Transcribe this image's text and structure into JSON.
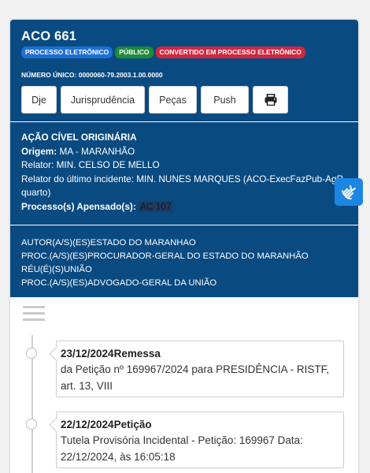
{
  "process": {
    "title": "ACO 661",
    "badges": [
      {
        "label": "PROCESSO ELETRÔNICO",
        "color": "#1d6fd6"
      },
      {
        "label": "PÚBLICO",
        "color": "#1f8a3a"
      },
      {
        "label": "CONVERTIDO EM PROCESSO ELETRÔNICO",
        "color": "#d3263f"
      }
    ],
    "numero_unico": "NÚMERO ÚNICO: 0000060-79.2003.1.00.0000"
  },
  "buttons": {
    "dje": "Dje",
    "jurisprudencia": "Jurisprudência",
    "pecas": "Peças",
    "push": "Push",
    "print_icon": "printer-icon"
  },
  "info": {
    "classe": "AÇÃO CÍVEL ORIGINÁRIA",
    "origem_label": "Origem:",
    "origem_value": "MA - MARANHÃO",
    "relator": "Relator: MIN. CELSO DE MELLO",
    "relator_ultimo": "Relator do último incidente: MIN. NUNES MARQUES (ACO-ExecFazPub-AgR-quarto)",
    "apensado_label": "Processo(s) Apensado(s):",
    "apensado_value": "AC 107"
  },
  "parts": [
    "AUTOR(A/S)(ES)ESTADO DO MARANHAO",
    "PROC.(A/S)(ES)PROCURADOR-GERAL DO ESTADO DO MARANHÃO",
    "RÉU(É)(S)UNIÃO",
    "PROC.(A/S)(ES)ADVOGADO-GERAL DA UNIÃO"
  ],
  "accessibility_icon": "sign-language-hand-icon",
  "timeline": [
    {
      "title": "23/12/2024Remessa",
      "desc": "da Petição nº 169967/2024 para PRESIDÊNCIA - RISTF, art. 13, VIII"
    },
    {
      "title": "22/12/2024Petição",
      "desc": "Tutela Provisória Incidental - Petição: 169967 Data: 22/12/2024, às 16:05:18"
    }
  ]
}
